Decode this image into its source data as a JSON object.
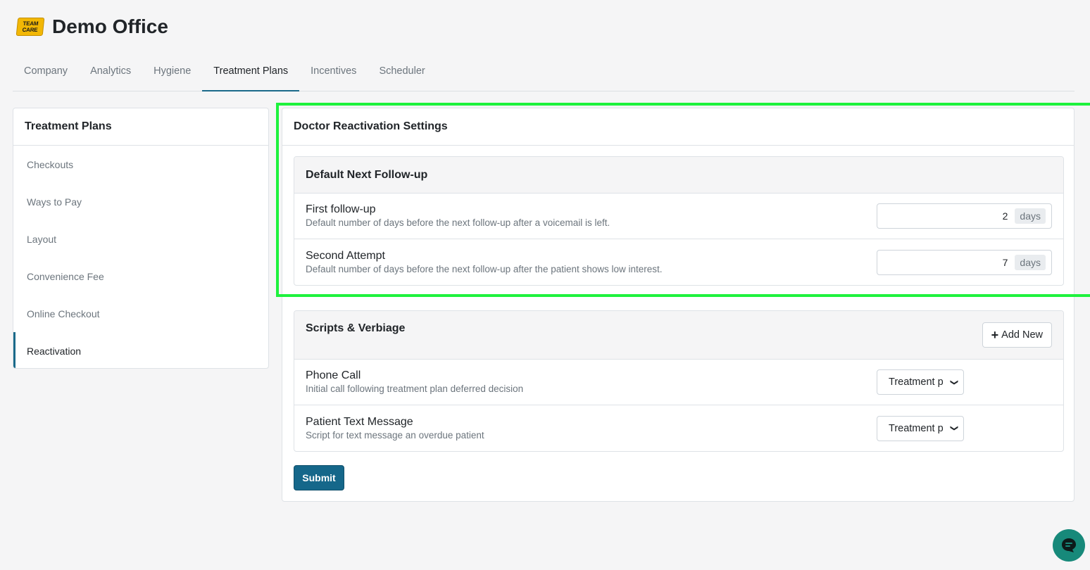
{
  "app": {
    "logo_line1": "TEAM",
    "logo_line2": "CARE",
    "title": "Demo Office"
  },
  "tabs": [
    {
      "label": "Company"
    },
    {
      "label": "Analytics"
    },
    {
      "label": "Hygiene"
    },
    {
      "label": "Treatment Plans",
      "active": true
    },
    {
      "label": "Incentives"
    },
    {
      "label": "Scheduler"
    }
  ],
  "sidebar": {
    "title": "Treatment Plans",
    "items": [
      {
        "label": "Checkouts"
      },
      {
        "label": "Ways to Pay"
      },
      {
        "label": "Layout"
      },
      {
        "label": "Convenience Fee"
      },
      {
        "label": "Online Checkout"
      },
      {
        "label": "Reactivation",
        "active": true
      }
    ]
  },
  "main": {
    "title": "Doctor Reactivation Settings",
    "followup": {
      "title": "Default Next Follow-up",
      "rows": [
        {
          "label": "First follow-up",
          "desc": "Default number of days before the next follow-up after a voicemail is left.",
          "value": "2",
          "unit": "days"
        },
        {
          "label": "Second Attempt",
          "desc": "Default number of days before the next follow-up after the patient shows low interest.",
          "value": "7",
          "unit": "days"
        }
      ]
    },
    "scripts": {
      "title": "Scripts & Verbiage",
      "add_label": "Add New",
      "rows": [
        {
          "label": "Phone Call",
          "desc": "Initial call following treatment plan deferred decision",
          "selected": "Treatment p"
        },
        {
          "label": "Patient Text Message",
          "desc": "Script for text message an overdue patient",
          "selected": "Treatment p"
        }
      ]
    },
    "submit_label": "Submit"
  },
  "colors": {
    "accent": "#15678a",
    "highlight": "#1ef23d",
    "chat": "#17897a"
  }
}
